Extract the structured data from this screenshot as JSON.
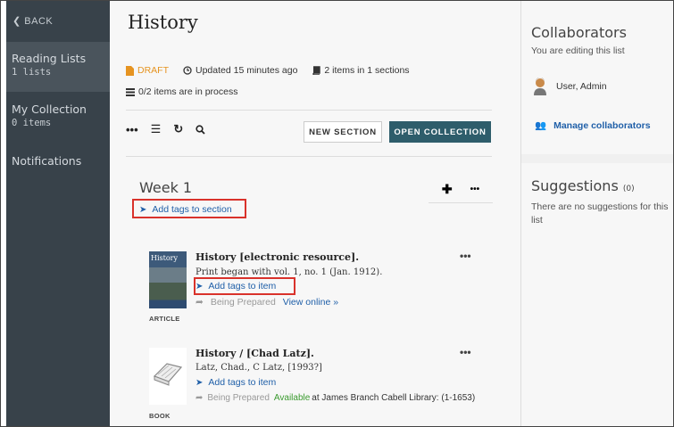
{
  "sidebar": {
    "back_label": "BACK",
    "items": [
      {
        "label": "Reading Lists",
        "sub": "1 lists"
      },
      {
        "label": "My Collection",
        "sub": "0 items"
      },
      {
        "label": "Notifications",
        "sub": ""
      }
    ]
  },
  "list": {
    "title": "History",
    "status": "DRAFT",
    "updated": "Updated 15 minutes ago",
    "items_in_sections": "2 items in 1 sections",
    "in_process": "0/2 items are in process"
  },
  "toolbar": {
    "new_section": "NEW SECTION",
    "open_collection": "OPEN COLLECTION"
  },
  "section": {
    "name": "Week 1",
    "add_tags": "Add tags to section"
  },
  "items": [
    {
      "title": "History [electronic resource].",
      "description": "Print began with vol. 1, no. 1 (Jan. 1912).",
      "add_tags": "Add tags to item",
      "status": "Being Prepared",
      "link": "View online  »",
      "type": "ARTICLE",
      "thumb_text": "History"
    },
    {
      "title": "History / [Chad Latz].",
      "description": "Latz, Chad., C Latz, [1993?]",
      "add_tags": "Add tags to item",
      "status": "Being Prepared",
      "availability": "Available",
      "location": "at James Branch Cabell Library: (1-1653)",
      "type": "BOOK"
    }
  ],
  "collaborators": {
    "heading": "Collaborators",
    "subtitle": "You are editing this list",
    "user": "User, Admin",
    "manage": "Manage collaborators"
  },
  "suggestions": {
    "heading": "Suggestions",
    "count": "(0)",
    "empty": "There are no suggestions for this list"
  },
  "colors": {
    "sidebar": "#38424a",
    "accent": "#2e5d6b",
    "link": "#1f5fa8",
    "draft": "#e69421",
    "available": "#3a9a2e",
    "highlight": "#d9322b"
  }
}
